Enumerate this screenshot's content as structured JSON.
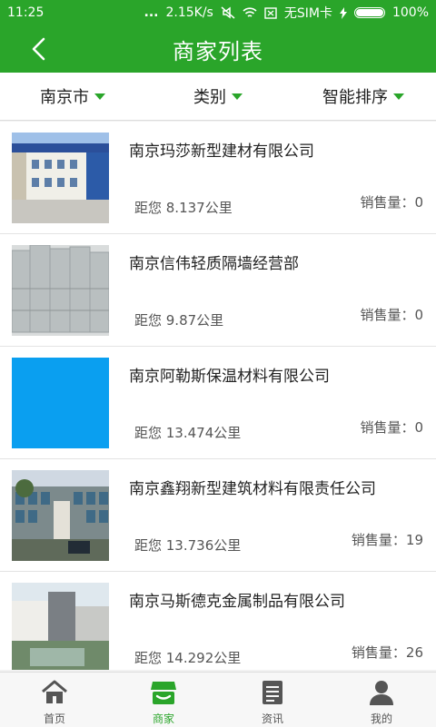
{
  "status": {
    "time": "11:25",
    "dots": "...",
    "speed": "2.15K/s",
    "sim": "无SIM卡",
    "battery": "100%"
  },
  "header": {
    "title": "商家列表"
  },
  "filters": [
    {
      "label": "南京市"
    },
    {
      "label": "类别"
    },
    {
      "label": "智能排序"
    }
  ],
  "merchants": [
    {
      "name": "南京玛莎新型建材有限公司",
      "distance": "距您 8.137公里",
      "sales": "销售量：0",
      "image": "building-photo"
    },
    {
      "name": "南京信伟轻质隔墙经营部",
      "distance": "距您 9.87公里",
      "sales": "销售量：0",
      "image": "block-stack-photo"
    },
    {
      "name": "南京阿勒斯保温材料有限公司",
      "distance": "距您 13.474公里",
      "sales": "销售量：0",
      "image": "blue-placeholder"
    },
    {
      "name": "南京鑫翔新型建筑材料有限责任公司",
      "distance": "距您 13.736公里",
      "sales": "销售量：19",
      "image": "office-building-photo"
    },
    {
      "name": "南京马斯德克金属制品有限公司",
      "distance": "距您 14.292公里",
      "sales": "销售量：26",
      "image": "courtyard-photo"
    }
  ],
  "tabs": [
    {
      "label": "首页",
      "icon": "home-icon"
    },
    {
      "label": "商家",
      "icon": "store-icon",
      "active": true
    },
    {
      "label": "资讯",
      "icon": "news-icon"
    },
    {
      "label": "我的",
      "icon": "user-icon"
    }
  ],
  "colors": {
    "accent": "#2aa52a",
    "placeholder": "#0a9ff0"
  }
}
